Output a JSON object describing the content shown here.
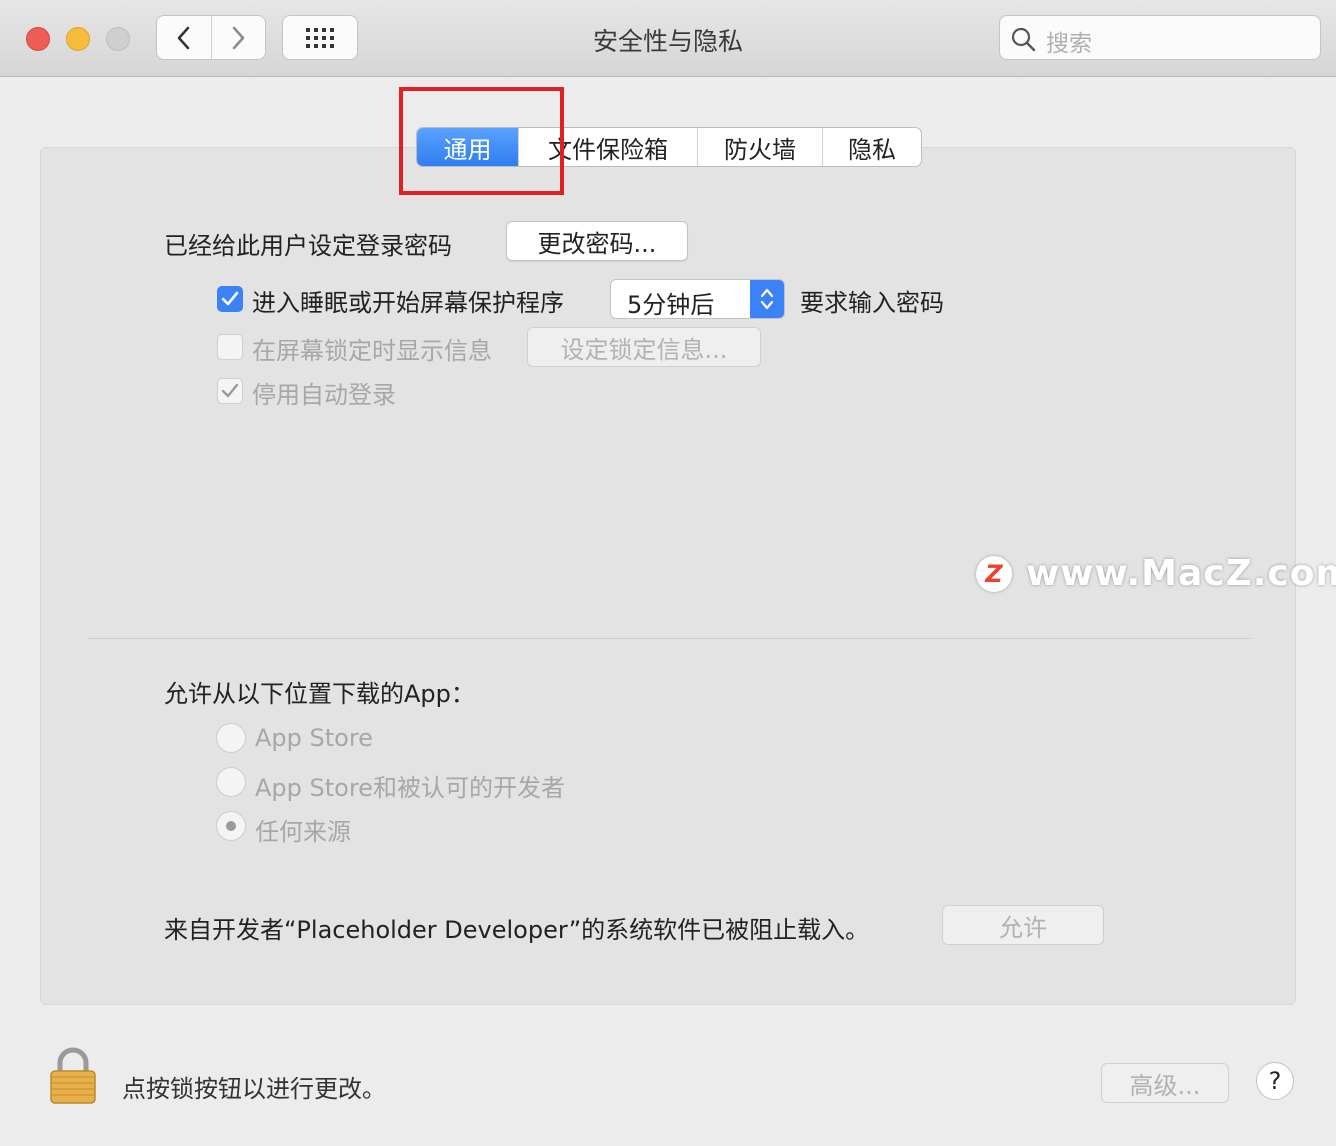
{
  "window": {
    "title": "安全性与隐私",
    "search_placeholder": "搜索"
  },
  "tabs": [
    {
      "label": "通用",
      "active": true
    },
    {
      "label": "文件保险箱",
      "active": false
    },
    {
      "label": "防火墙",
      "active": false
    },
    {
      "label": "隐私",
      "active": false
    }
  ],
  "general": {
    "password_set_label": "已经给此用户设定登录密码",
    "change_password_button": "更改密码...",
    "require_password_checkbox": {
      "checked": true,
      "label": "进入睡眠或开始屏幕保护程序"
    },
    "require_password_delay": "5分钟后",
    "require_password_suffix": "要求输入密码",
    "lock_message_checkbox": {
      "checked": false,
      "label": "在屏幕锁定时显示信息"
    },
    "set_lock_message_button": "设定锁定信息...",
    "disable_auto_login_checkbox": {
      "checked": true,
      "label": "停用自动登录"
    }
  },
  "downloads": {
    "title": "允许从以下位置下载的App：",
    "options": [
      {
        "label": "App Store",
        "selected": false
      },
      {
        "label": "App Store和被认可的开发者",
        "selected": false
      },
      {
        "label": "任何来源",
        "selected": true
      }
    ]
  },
  "blocked": {
    "message": "来自开发者“Placeholder Developer”的系统软件已被阻止载入。",
    "allow_button": "允许"
  },
  "footer": {
    "lock_text": "点按锁按钮以进行更改。",
    "advanced_button": "高级...",
    "help_button": "?"
  },
  "watermark": {
    "logo": "Z",
    "text": "www.MacZ.com"
  },
  "colors": {
    "accent": "#3b82f6",
    "highlight_box": "#e02121",
    "close": "#ee5d55",
    "minimize": "#f5bd3a",
    "zoom_disabled": "#cfcfcf"
  }
}
